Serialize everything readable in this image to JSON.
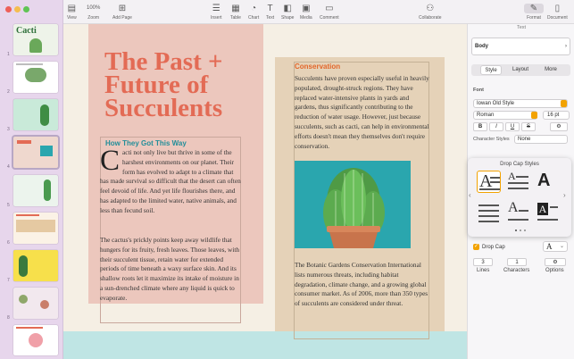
{
  "toolbar": {
    "view": "View",
    "zoom_value": "100%",
    "zoom": "Zoom",
    "add_page": "Add Page",
    "insert": "Insert",
    "table": "Table",
    "chart": "Chart",
    "text": "Text",
    "shape": "Shape",
    "media": "Media",
    "comment": "Comment",
    "collaborate": "Collaborate",
    "format": "Format",
    "document": "Document"
  },
  "thumbnails": {
    "page1_title": "Cacti",
    "numbers": [
      "1",
      "2",
      "3",
      "4",
      "5",
      "6",
      "7",
      "8",
      "9"
    ]
  },
  "document": {
    "title": "The Past + Future of Succulents",
    "left_heading": "How They Got This Way",
    "dropcap_letter": "C",
    "left_p1": "acti not only live but thrive in some of the harshest environments on our planet. Their form has evolved to adapt to a climate that has made survival so difficult that the desert can often feel devoid of life. And yet life flourishes there, and has adapted to the limited water, native animals, and less than fecund soil.",
    "left_p2": "The cactus's prickly points keep away wildlife that hungers for its fruity, fresh leaves. Those leaves, with their succulent tissue, retain water for extended periods of time beneath a waxy surface skin. And its shallow roots let it maximize its intake of moisture in a sun-drenched climate where any liquid is quick to evaporate.",
    "right_heading": "Conservation",
    "right_p1": "Succulents have proven especially useful in heavily populated, drought-struck regions. They have replaced water-intensive plants in yards and gardens, thus significantly contributing to the reduction of water usage. However, just because succulents, such as cacti, can help in environmental efforts doesn't mean they themselves don't require conservation.",
    "right_p2": "The Botanic Gardens Conservation International lists numerous threats, including habitat degradation, climate change, and a growing global consumer market. As of 2006, more than 350 types of succulents are considered under threat."
  },
  "inspector": {
    "title": "Text",
    "paragraph_style": "Body",
    "tabs": [
      "Style",
      "Layout",
      "More"
    ],
    "font_label": "Font",
    "font_family": "Iowan Old Style",
    "font_face": "Roman",
    "font_size": "16 pt",
    "bold": "B",
    "italic": "I",
    "underline": "U",
    "strike": "S",
    "char_styles_label": "Character Styles",
    "char_styles_value": "None",
    "drop_cap_styles_title": "Drop Cap Styles",
    "drop_cap_label": "Drop Cap",
    "lines_value": "3",
    "lines_label": "Lines",
    "characters_value": "1",
    "characters_label": "Characters",
    "options_label": "Options"
  }
}
